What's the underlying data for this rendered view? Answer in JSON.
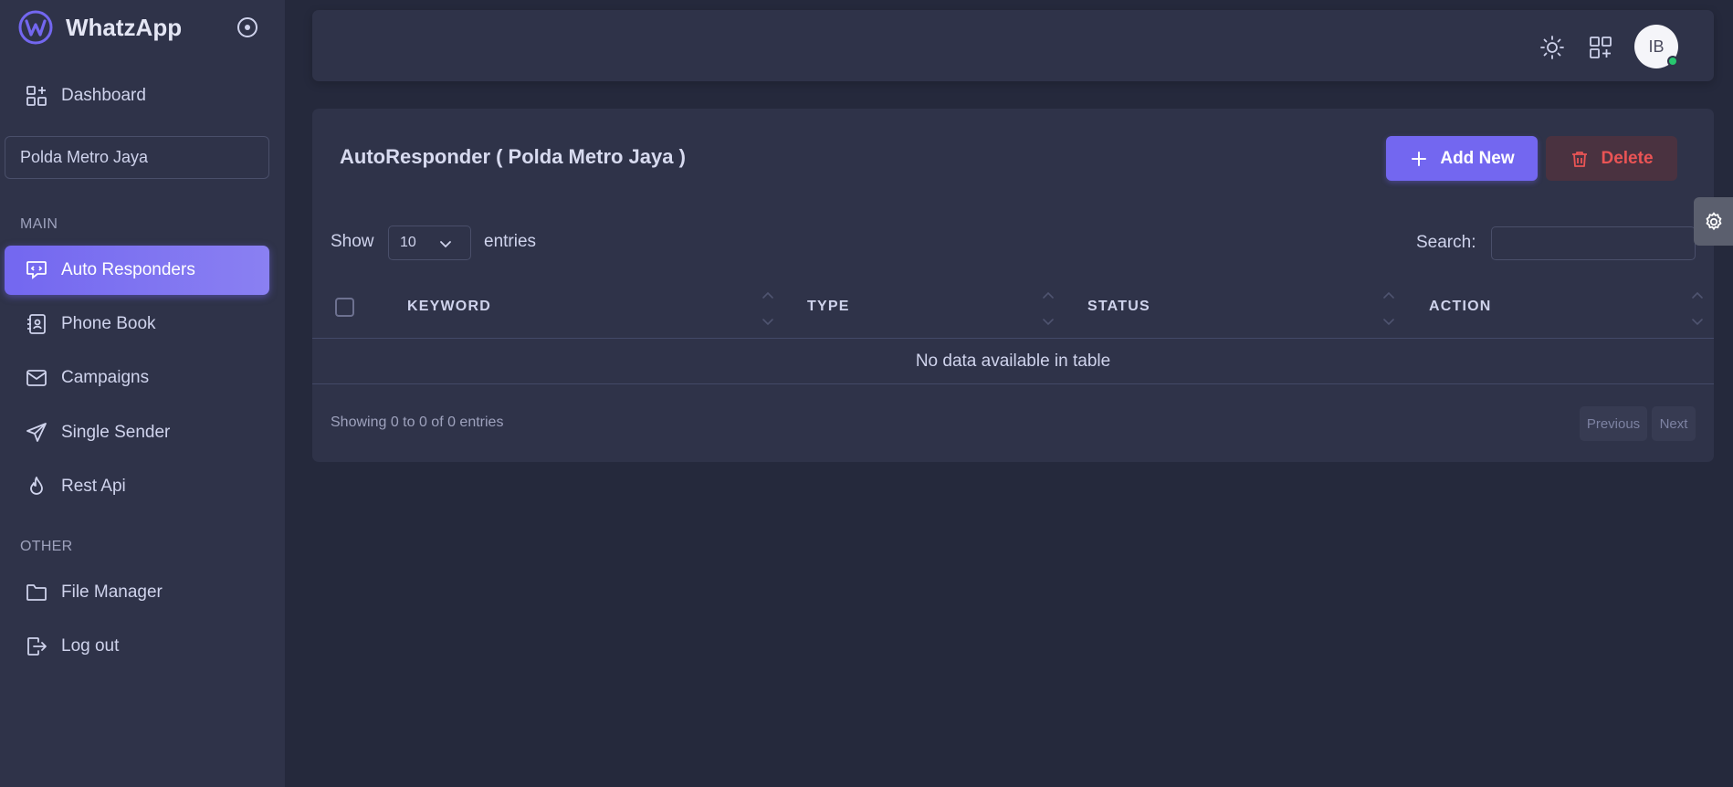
{
  "brand": {
    "name": "WhatzApp"
  },
  "sidebar": {
    "dashboard_label": "Dashboard",
    "device_select": "Polda Metro Jaya",
    "section_main": "MAIN",
    "section_other": "OTHER",
    "main_items": [
      {
        "label": "Auto Responders",
        "icon": "message-bot-icon",
        "active": true
      },
      {
        "label": "Phone Book",
        "icon": "address-book-icon"
      },
      {
        "label": "Campaigns",
        "icon": "mail-icon"
      },
      {
        "label": "Single Sender",
        "icon": "send-icon"
      },
      {
        "label": "Rest Api",
        "icon": "flame-icon"
      }
    ],
    "other_items": [
      {
        "label": "File Manager",
        "icon": "folder-icon"
      },
      {
        "label": "Log out",
        "icon": "logout-icon"
      }
    ]
  },
  "topbar": {
    "avatar_initials": "IB"
  },
  "card": {
    "title": "AutoResponder ( Polda Metro Jaya )",
    "add_label": "Add New",
    "delete_label": "Delete"
  },
  "table": {
    "show_label": "Show",
    "length_value": "10",
    "entries_label": "entries",
    "search_label": "Search:",
    "columns": [
      "KEYWORD",
      "TYPE",
      "STATUS",
      "ACTION"
    ],
    "empty_text": "No data available in table",
    "info": "Showing 0 to 0 of 0 entries",
    "prev_label": "Previous",
    "next_label": "Next"
  },
  "colors": {
    "accent": "#7367f0",
    "danger": "#ea5455",
    "online": "#28c76f"
  }
}
